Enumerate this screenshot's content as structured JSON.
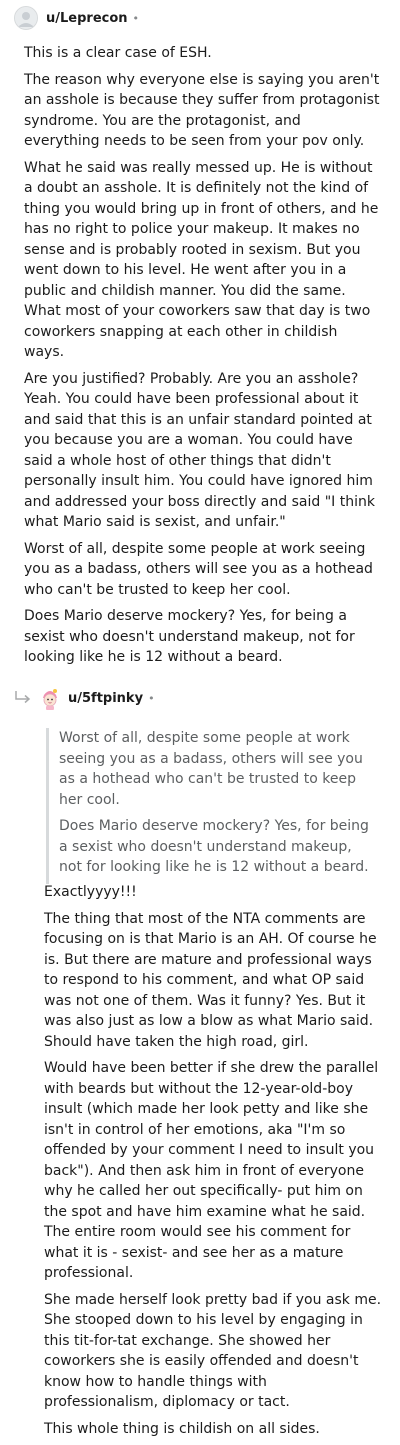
{
  "comment1": {
    "username": "u/Leprecon",
    "dot": "•",
    "paragraphs": [
      "This is a clear case of ESH.",
      "The reason why everyone else is saying you aren't an asshole is because they suffer from protagonist syndrome. You are the protagonist, and everything needs to be seen from your pov only.",
      "What he said was really messed up. He is without a doubt an asshole. It is definitely not the kind of thing you would bring up in front of others, and he has no right to police your makeup. It makes no sense and is probably rooted in sexism. But you went down to his level. He went after you in a public and childish manner. You did the same. What most of your coworkers saw that day is two coworkers snapping at each other in childish ways.",
      "Are you justified? Probably. Are you an asshole? Yeah. You could have been professional about it and said that this is an unfair standard pointed at you because you are a woman. You could have said a whole host of other things that didn't personally insult him. You could have ignored him and addressed your boss directly and said \"I think what Mario said is sexist, and unfair.\"",
      "Worst of all, despite some people at work seeing you as a badass, others will see you as a hothead who can't be trusted to keep her cool.",
      "Does Mario deserve mockery? Yes, for being a sexist who doesn't understand makeup, not for looking like he is 12 without a beard."
    ]
  },
  "comment2": {
    "username": "u/5ftpinky",
    "dot": "•",
    "quote": [
      "Worst of all, despite some people at work seeing you as a badass, others will see you as a hothead who can't be trusted to keep her cool.",
      "Does Mario deserve mockery? Yes, for being a sexist who doesn't understand makeup, not for looking like he is 12 without a beard."
    ],
    "paragraphs": [
      "Exactlyyyy!!!",
      "The thing that most of the NTA comments are focusing on is that Mario is an AH. Of course he is. But there are mature and professional ways to respond to his comment, and what OP said was not one of them. Was it funny? Yes. But it was also just as low a blow as what Mario said. Should have taken the high road, girl.",
      "Would have been better if she drew the parallel with beards but without the 12-year-old-boy insult (which made her look petty and like she isn't in control of her emotions, aka \"I'm so offended by your comment I need to insult you back\"). And then ask him in front of everyone why he called her out specifically- put him on the spot and have him examine what he said. The entire room would see his comment for what it is - sexist- and see her as a mature professional.",
      "She made herself look pretty bad if you ask me. She stooped down to his level by engaging in this tit-for-tat exchange. She showed her coworkers she is easily offended and doesn't know how to handle things with professionalism, diplomacy or tact.",
      "This whole thing is childish on all sides."
    ]
  },
  "colors": {
    "text": "#1c1c1c",
    "quote_text": "#5c5f61",
    "quote_bar": "#d7dadc",
    "meta": "#878a8c"
  },
  "icons": {
    "avatar1": "default-avatar-icon",
    "avatar2": "pink-character-avatar-icon",
    "reply": "reply-arrow-icon"
  }
}
